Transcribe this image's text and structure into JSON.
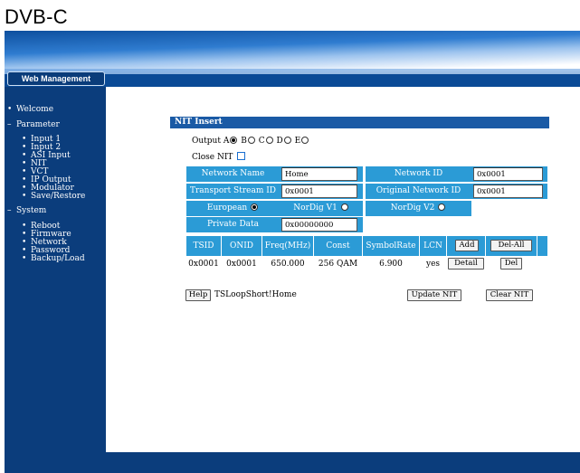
{
  "caption": "DVB-C",
  "header": {
    "tab_label": "Web Management"
  },
  "sidebar": {
    "items": [
      {
        "bullet": "•",
        "label": "Welcome"
      },
      {
        "bullet": "–",
        "label": "Parameter"
      },
      {
        "bullet": "•",
        "label": "Input 1"
      },
      {
        "bullet": "•",
        "label": "Input 2"
      },
      {
        "bullet": "•",
        "label": "ASI Input"
      },
      {
        "bullet": "•",
        "label": "NIT"
      },
      {
        "bullet": "•",
        "label": "VCT"
      },
      {
        "bullet": "•",
        "label": "IP Output"
      },
      {
        "bullet": "•",
        "label": "Modulator"
      },
      {
        "bullet": "•",
        "label": "Save/Restore"
      },
      {
        "bullet": "–",
        "label": "System"
      },
      {
        "bullet": "•",
        "label": "Reboot"
      },
      {
        "bullet": "•",
        "label": "Firmware"
      },
      {
        "bullet": "•",
        "label": "Network"
      },
      {
        "bullet": "•",
        "label": "Password"
      },
      {
        "bullet": "•",
        "label": "Backup/Load"
      }
    ]
  },
  "panel": {
    "title": "NIT Insert",
    "output_label": "Output",
    "outputs": [
      "A",
      "B",
      "C",
      "D",
      "E"
    ],
    "selected_output": "A",
    "close_nit_label": "Close NIT",
    "close_nit_checked": false,
    "fields": {
      "network_name_label": "Network Name",
      "network_name_value": "Home",
      "network_id_label": "Network ID",
      "network_id_value": "0x0001",
      "tsid_label": "Transport Stream ID",
      "tsid_value": "0x0001",
      "onid_label": "Original Network ID",
      "onid_value": "0x0001",
      "european_label": "European",
      "nordig_v1_label": "NorDig V1",
      "nordig_v2_label": "NorDig V2",
      "lcn_mode_selected": "European",
      "private_data_label": "Private Data",
      "private_data_value": "0x00000000"
    },
    "table": {
      "headers": [
        "TSID",
        "ONID",
        "Freq(MHz)",
        "Const",
        "SymbolRate",
        "LCN"
      ],
      "add_label": "Add",
      "del_all_label": "Del-All",
      "rows": [
        {
          "tsid": "0x0001",
          "onid": "0x0001",
          "freq": "650.000",
          "const": "256 QAM",
          "symbol_rate": "6.900",
          "lcn": "yes",
          "detail_label": "Detail",
          "del_label": "Del"
        }
      ]
    },
    "help_label": "Help",
    "status_text": "TSLoopShort!Home",
    "update_label": "Update NIT",
    "clear_label": "Clear NIT"
  },
  "colors": {
    "nav_blue": "#0b3d7c",
    "cell_blue": "#2b9bd6",
    "header_blue": "#1a5aa5"
  }
}
